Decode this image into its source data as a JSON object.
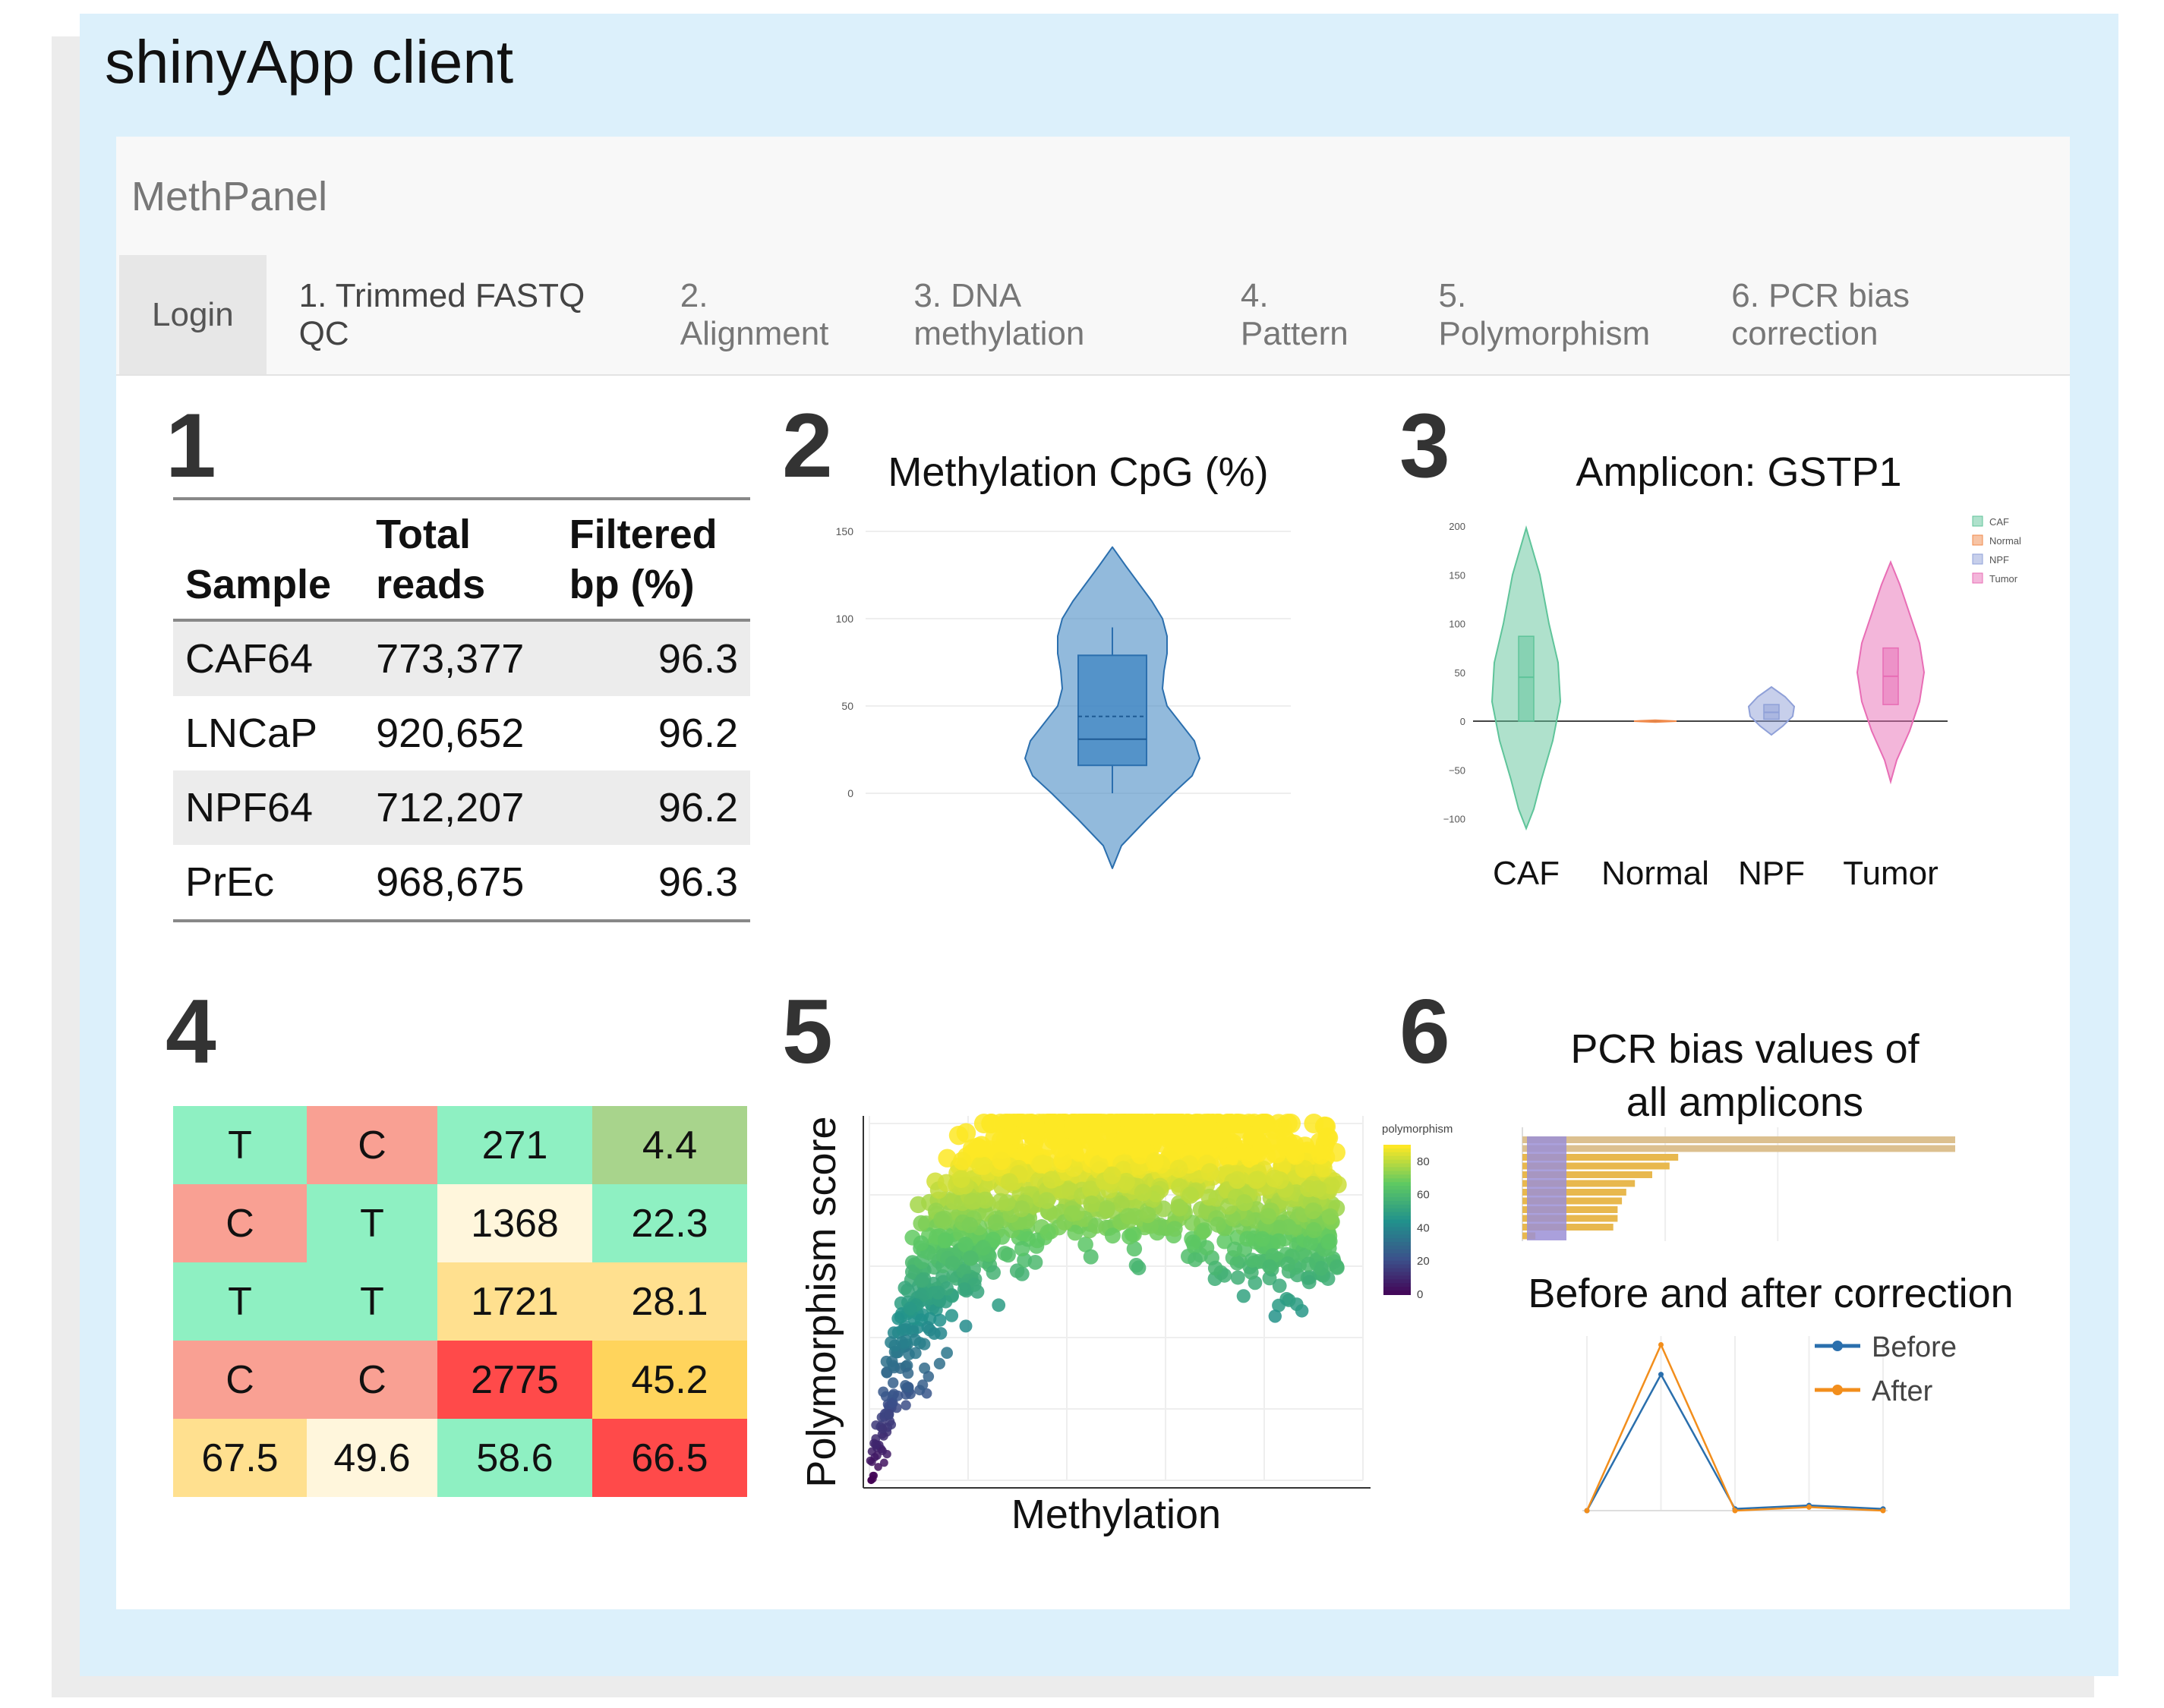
{
  "client_title": "shinyApp client",
  "app": {
    "brand": "MethPanel",
    "tabs": [
      "Login",
      "1. Trimmed FASTQ QC",
      "2. Alignment",
      "3. DNA methylation",
      "4. Pattern",
      "5. Polymorphism",
      "6. PCR bias correction"
    ]
  },
  "panel_numbers": [
    "1",
    "2",
    "3",
    "4",
    "5",
    "6"
  ],
  "qc_table": {
    "headers": [
      [
        "Sample",
        ""
      ],
      [
        "Total",
        "reads"
      ],
      [
        "Filtered",
        "bp (%)"
      ]
    ],
    "rows": [
      [
        "CAF64",
        "773,377",
        "96.3"
      ],
      [
        "LNCaP",
        "920,652",
        "96.2"
      ],
      [
        "NPF64",
        "712,207",
        "96.2"
      ],
      [
        "PrEc",
        "968,675",
        "96.3"
      ]
    ]
  },
  "heatmap": {
    "rows": [
      [
        {
          "text": "T",
          "color": "#8ef0c2"
        },
        {
          "text": "C",
          "color": "#f9a093"
        },
        {
          "text": "271",
          "color": "#8ef0c2"
        },
        {
          "text": "4.4",
          "color": "#a8d48c"
        }
      ],
      [
        {
          "text": "C",
          "color": "#f9a093"
        },
        {
          "text": "T",
          "color": "#8ef0c2"
        },
        {
          "text": "1368",
          "color": "#fff6dc"
        },
        {
          "text": "22.3",
          "color": "#8ef0c2"
        }
      ],
      [
        {
          "text": "T",
          "color": "#8ef0c2"
        },
        {
          "text": "T",
          "color": "#8ef0c2"
        },
        {
          "text": "1721",
          "color": "#ffe08f"
        },
        {
          "text": "28.1",
          "color": "#ffe08f"
        }
      ],
      [
        {
          "text": "C",
          "color": "#f9a093"
        },
        {
          "text": "C",
          "color": "#f9a093"
        },
        {
          "text": "2775",
          "color": "#ff4a4a"
        },
        {
          "text": "45.2",
          "color": "#ffd45c"
        }
      ],
      [
        {
          "text": "67.5",
          "color": "#ffe08f"
        },
        {
          "text": "49.6",
          "color": "#fff6dc"
        },
        {
          "text": "58.6",
          "color": "#8ef0c2"
        },
        {
          "text": "66.5",
          "color": "#ff4a4a"
        }
      ]
    ]
  },
  "chart_data": [
    {
      "type": "violin",
      "title": "Methylation CpG (%)",
      "y_ticks": [
        "0",
        "50",
        "100",
        "150"
      ],
      "ylim": [
        -45,
        155
      ],
      "box": {
        "min": 0,
        "q1": 16,
        "median": 31,
        "mean": 44,
        "q3": 79,
        "max": 95
      },
      "extent": [
        -43,
        141
      ],
      "color": "#4a8cc4"
    },
    {
      "type": "violin",
      "title": "Amplicon: GSTP1",
      "y_ticks": [
        "200",
        "150",
        "100",
        "50",
        "0",
        "−50",
        "−100"
      ],
      "ylim": [
        -112,
        202
      ],
      "categories": [
        "CAF",
        "Normal",
        "NPF",
        "Tumor"
      ],
      "legend": [
        "CAF",
        "Normal",
        "NPF",
        "Tumor"
      ],
      "colors": [
        "#5fc49a",
        "#f08a4b",
        "#8fa0d8",
        "#e86db5"
      ],
      "series": [
        {
          "name": "CAF",
          "min": -110,
          "max": 198,
          "q1": 0,
          "median": 45,
          "q3": 87
        },
        {
          "name": "Normal",
          "min": -1,
          "max": 1,
          "q1": 0,
          "median": 0,
          "q3": 0
        },
        {
          "name": "NPF",
          "min": -14,
          "max": 35,
          "q1": 2,
          "median": 9,
          "q3": 17
        },
        {
          "name": "Tumor",
          "min": -62,
          "max": 163,
          "q1": 17,
          "median": 46,
          "q3": 75
        }
      ]
    },
    {
      "type": "scatter",
      "xlabel": "Methylation",
      "ylabel": "Polymorphism score",
      "colorbar_title": "polymorphism",
      "colorbar_ticks": [
        "80",
        "60",
        "40",
        "20",
        "0"
      ],
      "xlim": [
        0,
        100
      ],
      "ylim": [
        0,
        100
      ],
      "trend": "points rise from near 0 at low methylation to about 80–100 near 40–60% methylation, then fall to about 30–50 at high methylation"
    },
    {
      "type": "bar",
      "title": "PCR bias values of all amplicons",
      "orientation": "horizontal",
      "values": [
        100,
        100,
        36,
        34,
        30,
        26,
        24,
        23,
        22,
        22,
        21,
        3
      ],
      "colors": [
        "#dcc08f",
        "#e8b84e",
        "#9b8fd6"
      ]
    },
    {
      "type": "line",
      "title": "Before and after correction",
      "x": [
        1,
        2,
        3,
        4,
        5
      ],
      "series": [
        {
          "name": "Before",
          "values": [
            0,
            78,
            1,
            3,
            1
          ],
          "color": "#2a6fad"
        },
        {
          "name": "After",
          "values": [
            0,
            95,
            0,
            2,
            0
          ],
          "color": "#f28e1c"
        }
      ]
    }
  ]
}
